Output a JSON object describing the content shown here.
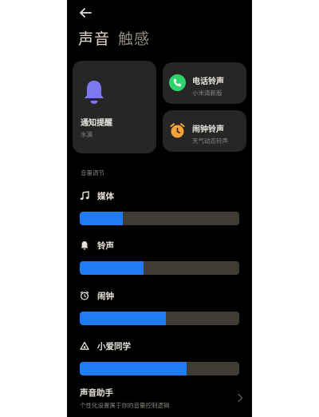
{
  "tabs": {
    "active": "声音",
    "inactive": "触感"
  },
  "cards": {
    "notification": {
      "title": "通知提醒",
      "subtitle": "水滴"
    },
    "ringtone": {
      "title": "电话铃声",
      "subtitle": "小米清新版"
    },
    "alarm": {
      "title": "闹钟铃声",
      "subtitle": "天气动态铃声"
    }
  },
  "section_label": "音量调节",
  "volumes": [
    {
      "label": "媒体",
      "icon": "music-note-icon",
      "level": 0.27
    },
    {
      "label": "铃声",
      "icon": "bell-icon",
      "level": 0.4
    },
    {
      "label": "闹钟",
      "icon": "alarm-clock-icon",
      "level": 0.54
    },
    {
      "label": "小爱同学",
      "icon": "xiaoai-icon",
      "level": 0.67
    }
  ],
  "assistant": {
    "title": "声音助手",
    "subtitle": "个性化设置属于你的音量控制逻辑"
  },
  "colors": {
    "accent": "#1f7cf2",
    "track": "#3f3b35",
    "card": "#262626",
    "bell": "#7d78ef",
    "phone": "#2fd36b",
    "alarm": "#f5a33a"
  }
}
